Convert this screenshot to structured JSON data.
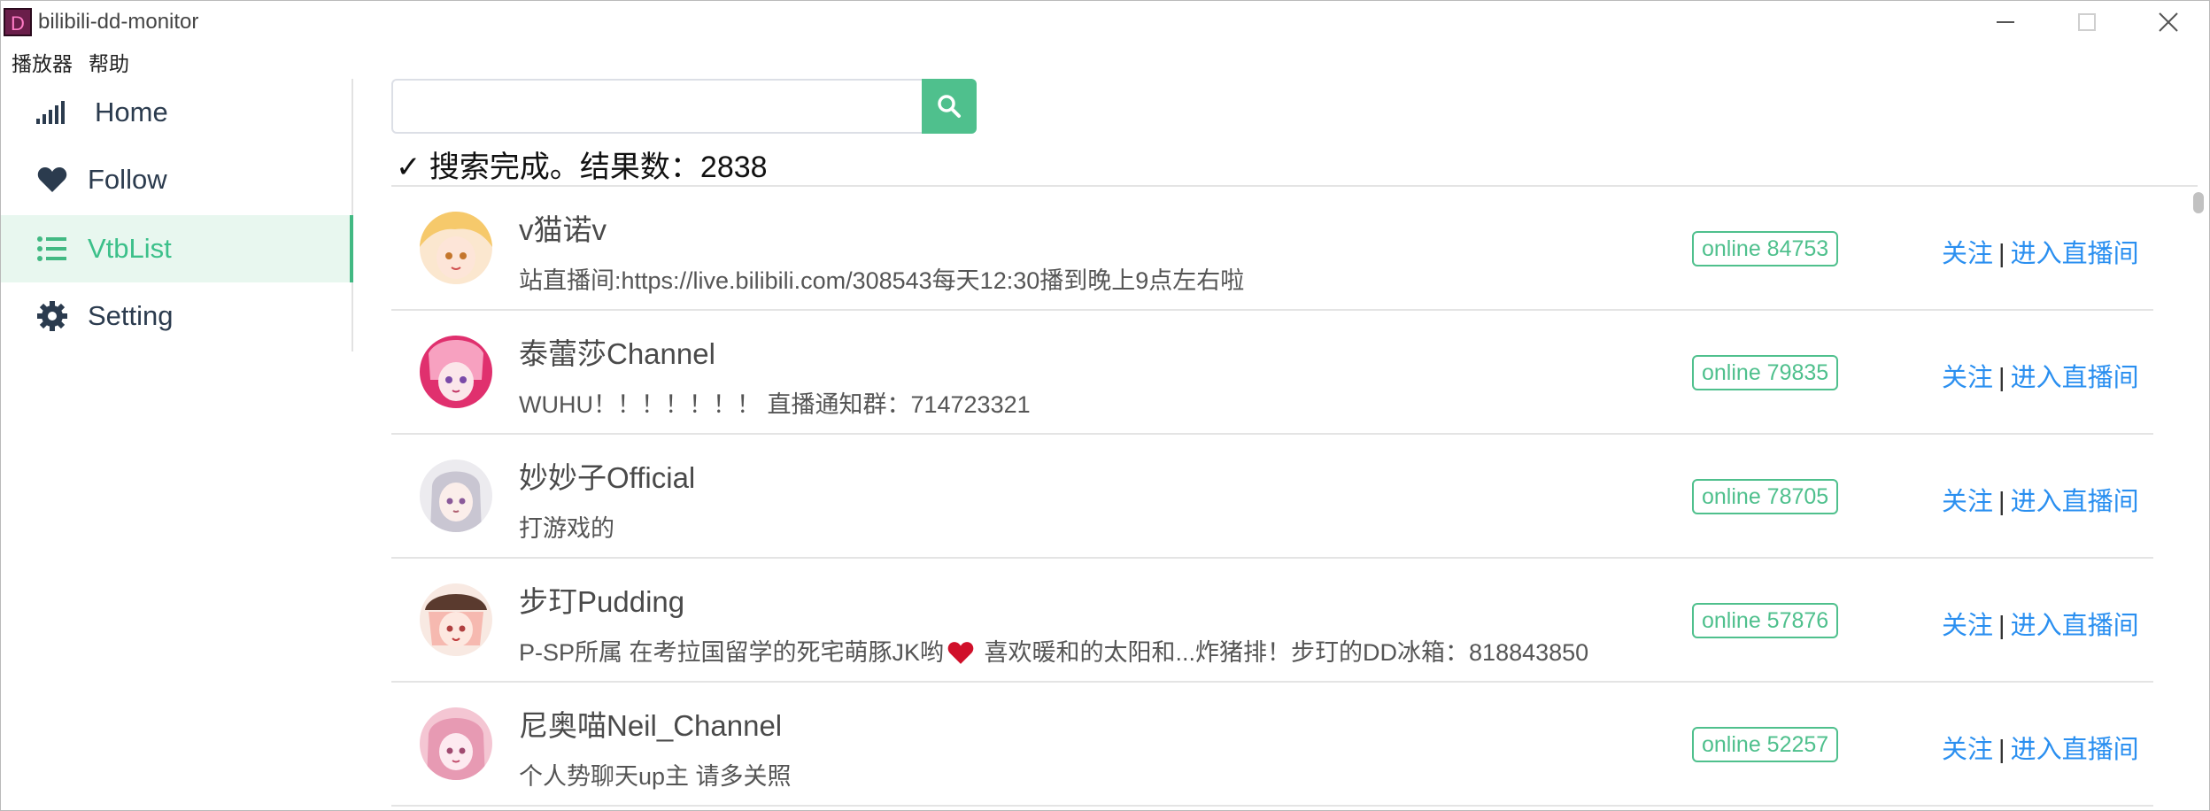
{
  "window": {
    "title": "bilibili-dd-monitor",
    "icon_letter": "D"
  },
  "menu": {
    "items": [
      "播放器",
      "帮助"
    ]
  },
  "sidebar": {
    "items": [
      {
        "label": "Home",
        "icon": "signal-bars-icon"
      },
      {
        "label": "Follow",
        "icon": "heart-icon"
      },
      {
        "label": "VtbList",
        "icon": "list-icon",
        "active": true
      },
      {
        "label": "Setting",
        "icon": "gear-icon"
      }
    ]
  },
  "search": {
    "value": "",
    "placeholder": "",
    "status": "✓ 搜索完成。结果数：2838"
  },
  "list": {
    "items": [
      {
        "name": "v猫诺v",
        "desc": "站直播间:https://live.bilibili.com/308543每天12:30播到晚上9点左右啦",
        "online": "online 84753",
        "follow": "关注",
        "enter": "进入直播间"
      },
      {
        "name": "泰蕾莎Channel",
        "desc": "WUHU！！！！！！！ 直播通知群：714723321",
        "online": "online 79835",
        "follow": "关注",
        "enter": "进入直播间"
      },
      {
        "name": "妙妙子Official",
        "desc": "打游戏的",
        "online": "online 78705",
        "follow": "关注",
        "enter": "进入直播间"
      },
      {
        "name": "步玎Pudding",
        "desc_before": "P-SP所属 在考拉国留学的死宅萌豚JK哟",
        "desc_after": " 喜欢暖和的太阳和...炸猪排！步玎的DD冰箱：818843850",
        "online": "online 57876",
        "follow": "关注",
        "enter": "进入直播间"
      },
      {
        "name": "尼奥喵Neil_Channel",
        "desc": "个人势聊天up主 请多关照",
        "online": "online 52257",
        "follow": "关注",
        "enter": "进入直播间"
      }
    ],
    "separator": "|"
  },
  "colors": {
    "accent": "#42b983",
    "link": "#2a8ff0",
    "active_bg": "#e8f7ef"
  }
}
